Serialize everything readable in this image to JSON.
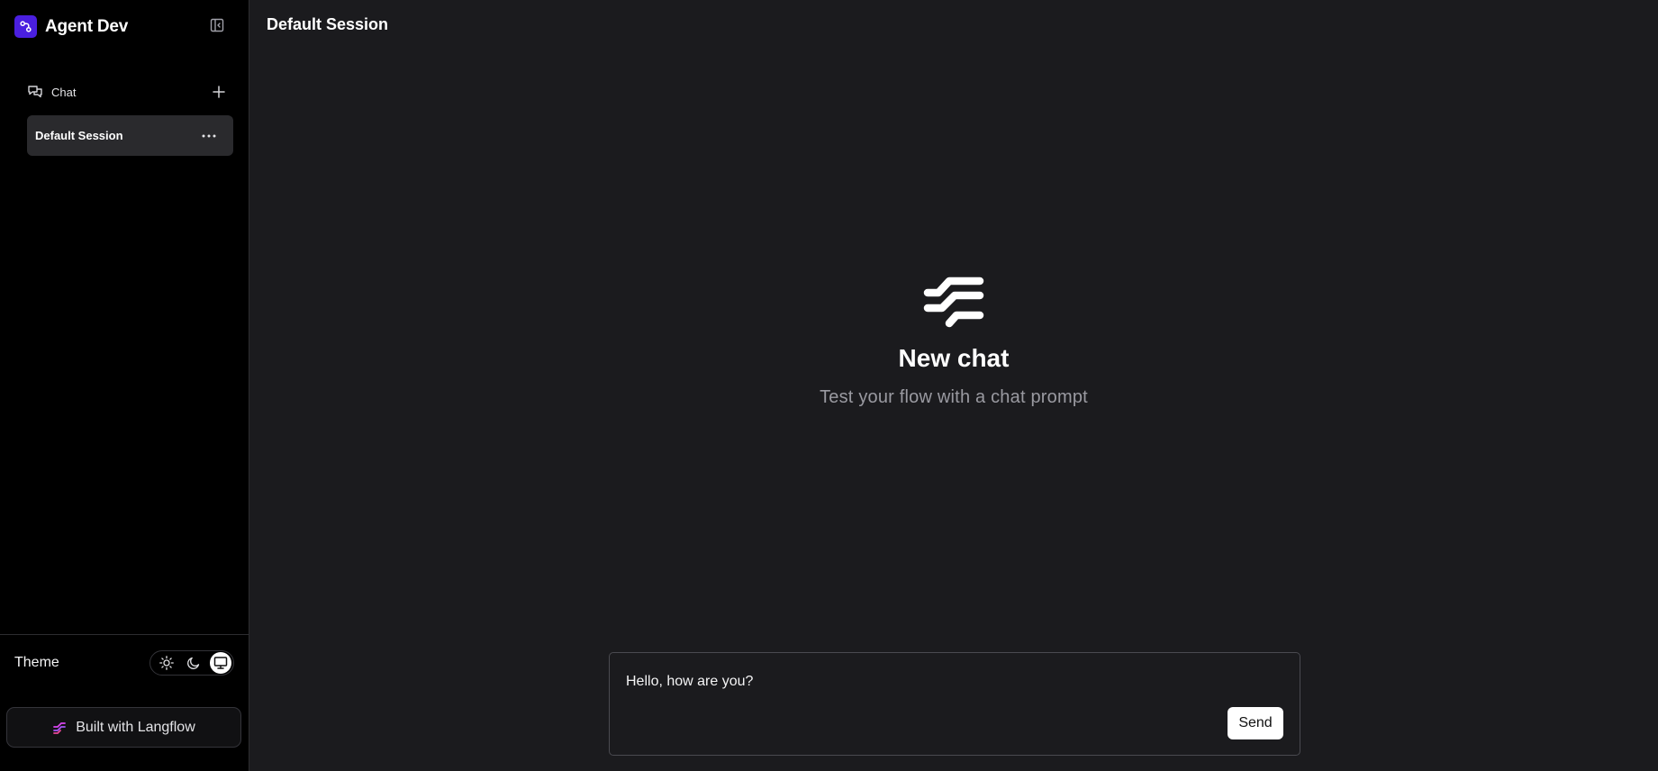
{
  "app": {
    "title": "Agent Dev",
    "brand_color": "#4a1fe0"
  },
  "icons": {
    "brand": "agent-logo-icon",
    "collapse": "sidebar-collapse-icon",
    "chat": "chat-bubbles-icon",
    "new_chat": "plus-icon",
    "more": "more-horizontal-icon",
    "theme_light": "sun-icon",
    "theme_dark": "moon-icon",
    "theme_system": "monitor-icon",
    "langflow": "langflow-icon",
    "empty_state": "langflow-logo-icon"
  },
  "sidebar": {
    "chat_label": "Chat",
    "sessions": [
      {
        "label": "Default Session",
        "selected": true
      }
    ],
    "theme_label": "Theme",
    "theme_selected": "system",
    "built_with_label": "Built with Langflow"
  },
  "main": {
    "title": "Default Session",
    "empty_title": "New chat",
    "empty_subtitle": "Test your flow with a chat prompt"
  },
  "composer": {
    "value": "Hello, how are you?",
    "send_label": "Send"
  },
  "colors": {
    "sidebar_bg": "#000000",
    "main_bg": "#1b1b1e",
    "selected_item_bg": "#2a2a2d",
    "muted_text": "#9a9aa1"
  }
}
